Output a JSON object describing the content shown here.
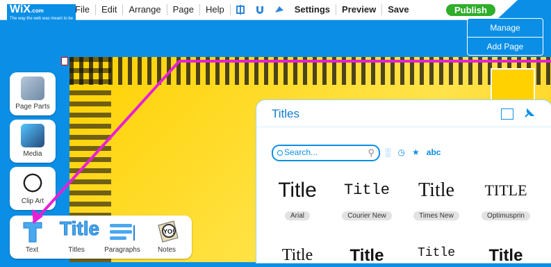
{
  "app": {
    "logo": "WiX",
    "logo_suffix": ".com",
    "tagline": "The way the web was meant to be"
  },
  "menu": {
    "items": [
      "File",
      "Edit",
      "Arrange",
      "Page",
      "Help"
    ],
    "icons": [
      "grid-icon",
      "magnet-icon",
      "shape-icon"
    ],
    "settings": "Settings",
    "preview": "Preview",
    "save": "Save",
    "publish": "Publish"
  },
  "page_dropdown": {
    "items": [
      "Manage",
      "Add Page"
    ]
  },
  "sidebar": {
    "tools": [
      "Page Parts",
      "Media",
      "Clip Art",
      "Text"
    ]
  },
  "text_bar": {
    "items": [
      "Titles",
      "Paragraphs",
      "Notes"
    ]
  },
  "titles_panel": {
    "title": "Titles",
    "search_placeholder": "Search...",
    "filters": [
      "abc"
    ],
    "styles": [
      {
        "sample": "Title",
        "name": "Arial"
      },
      {
        "sample": "Title",
        "name": "Courier New"
      },
      {
        "sample": "Title",
        "name": "Times New"
      },
      {
        "sample": "TITLE",
        "name": "Optimusprin"
      }
    ],
    "row2": [
      "Title",
      "Title",
      "Title",
      "Title"
    ]
  },
  "colors": {
    "toolbar_blue": "#0b8fe6",
    "publish_green": "#2fae2a",
    "canvas_yellow": "#ffd100",
    "arrow_magenta": "#e81fd7"
  }
}
